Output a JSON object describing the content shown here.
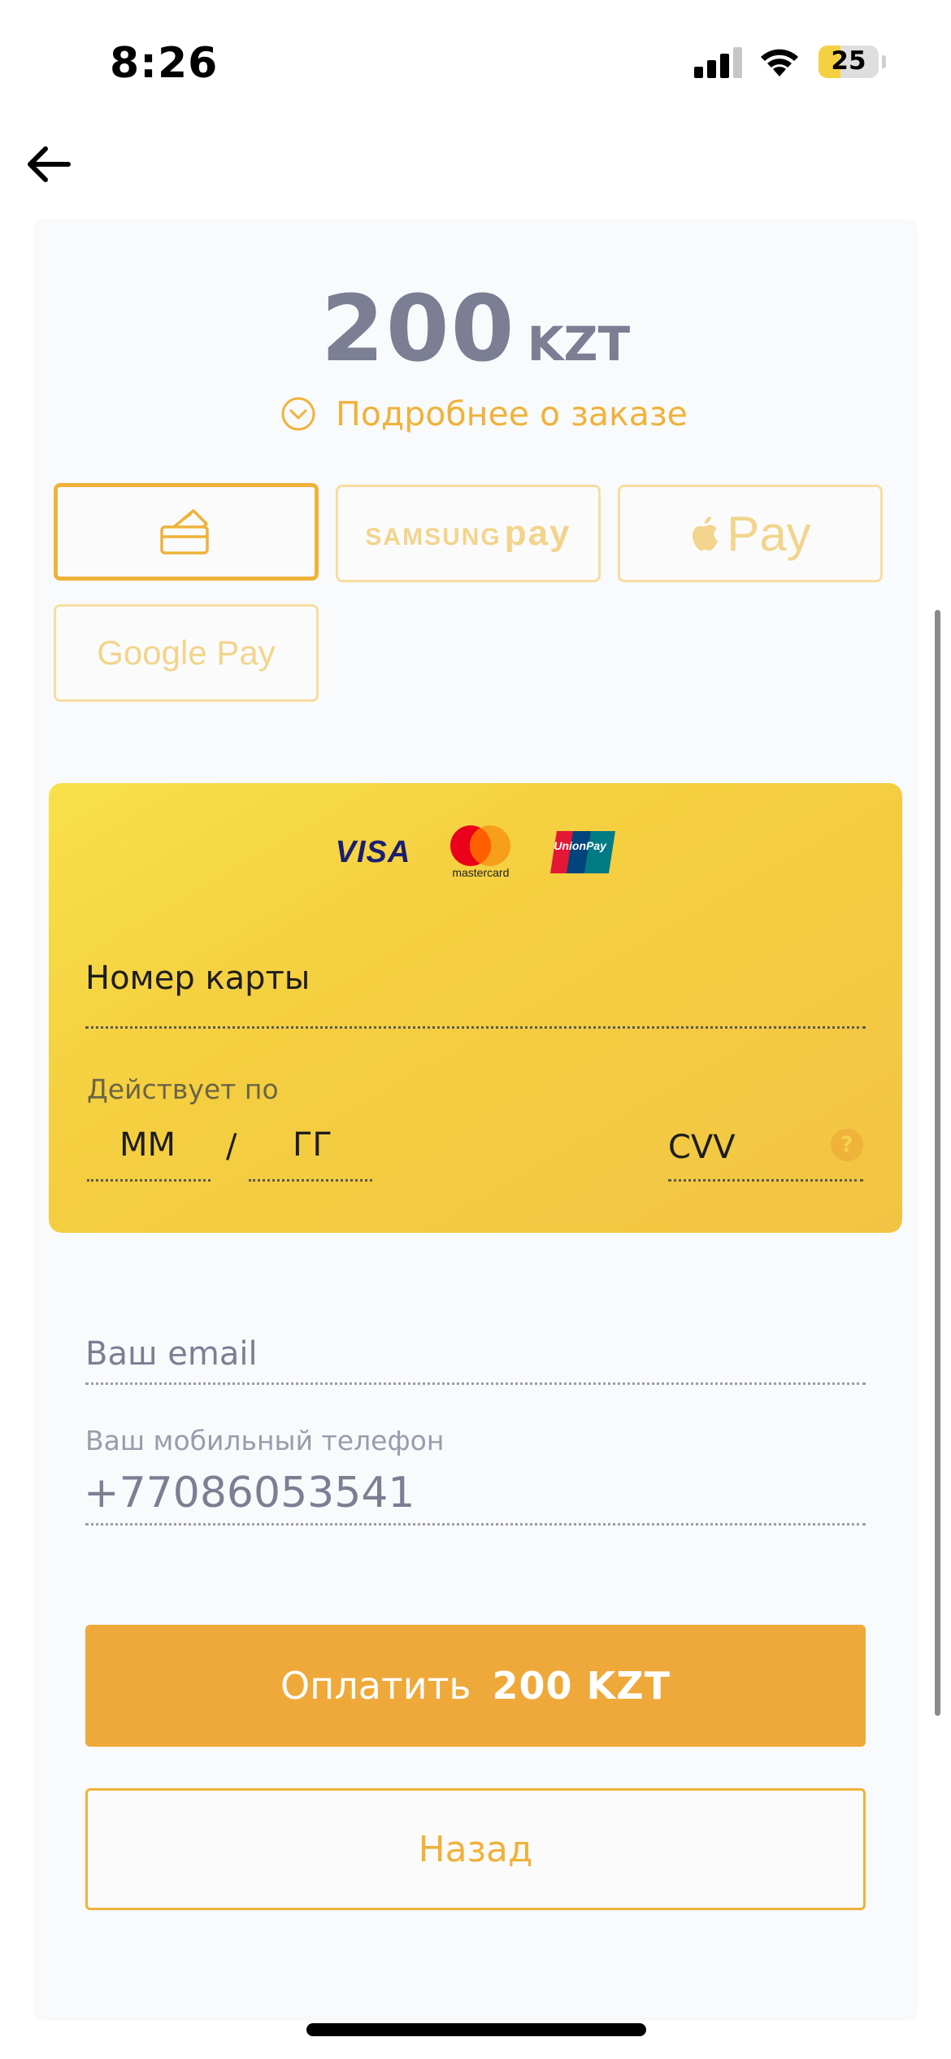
{
  "status_bar": {
    "time": "8:26",
    "battery": "25"
  },
  "order": {
    "amount": "200",
    "currency": "KZT",
    "details_link": "Подробнее о заказе"
  },
  "payment_methods": {
    "samsung_pay": {
      "brand": "SAMSUNG",
      "suffix": "pay"
    },
    "apple_pay": {
      "suffix": "Pay"
    },
    "google_pay": "Google Pay"
  },
  "card": {
    "brands": {
      "visa": "VISA",
      "mastercard": "mastercard",
      "unionpay": "UnionPay"
    },
    "number_placeholder": "Номер карты",
    "valid_thru_label": "Действует по",
    "month_placeholder": "ММ",
    "separator": "/",
    "year_placeholder": "ГГ",
    "cvv_placeholder": "CVV",
    "help": "?"
  },
  "form": {
    "email_placeholder": "Ваш email",
    "phone_label": "Ваш мобильный телефон",
    "phone_value": "+77086053541"
  },
  "actions": {
    "pay_label": "Оплатить",
    "pay_amount": "200 KZT",
    "back_label": "Назад"
  },
  "colors": {
    "accent": "#efb23a",
    "card_yellow": "#f5d040",
    "amount_gray": "#7c7f93"
  }
}
